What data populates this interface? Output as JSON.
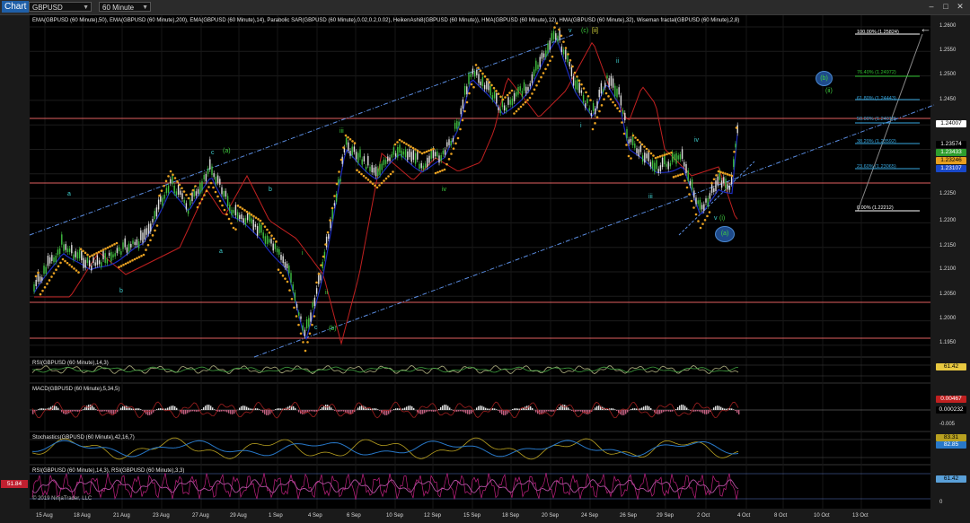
{
  "window": {
    "tab_label": "Chart",
    "symbol": "GBPUSD",
    "timeframe": "60 Minute",
    "min": "–",
    "max": "□",
    "close": "✕"
  },
  "main_panel": {
    "indicators_label": "EMA(GBPUSD (60 Minute),50), EMA(GBPUSD (60 Minute),200), EMA(GBPUSD (60 Minute),14), Parabolic SAR(GBPUSD (60 Minute),0.02,0.2,0.02), HeikenAshi8(GBPUSD (60 Minute)), HMA(GBPUSD (60 Minute),12), HMA(GBPUSD (60 Minute),32), Wiseman fractal(GBPUSD (60 Minute),2,8)",
    "price_ticks": [
      "1.2600",
      "1.2550",
      "1.2500",
      "1.2450",
      "1.2400",
      "1.2350",
      "1.2300",
      "1.2250",
      "1.2200",
      "1.2150",
      "1.2100",
      "1.2050",
      "1.2000",
      "1.1950"
    ],
    "price_tags": [
      {
        "label": "1.24007",
        "bg": "#ffffff",
        "fg": "#000000"
      },
      {
        "label": "1.23574",
        "bg": "#000000",
        "fg": "#ffffff"
      },
      {
        "label": "1.23433",
        "bg": "#2e9e2e",
        "fg": "#ffffff"
      },
      {
        "label": "1.23246",
        "bg": "#e8a020",
        "fg": "#000000"
      },
      {
        "label": "1.23107",
        "bg": "#1848c8",
        "fg": "#ffffff"
      }
    ],
    "fib_levels": [
      {
        "label": "100.00% (1.25824)",
        "color": "#ffffff"
      },
      {
        "label": "76.40% (1.24972)",
        "color": "#2ec02e"
      },
      {
        "label": "61.80% (1.24443)",
        "color": "#38a8e0"
      },
      {
        "label": "50.00% (1.24018)",
        "color": "#38a8e0"
      },
      {
        "label": "38.20% (1.23592)",
        "color": "#38a8e0"
      },
      {
        "label": "23.60% (1.23065)",
        "color": "#38a8e0"
      },
      {
        "label": "0.00% (1.22212)",
        "color": "#ffffff"
      }
    ],
    "wave_labels": [
      {
        "t": "a",
        "c": "#40d0d0"
      },
      {
        "t": "b",
        "c": "#40d0d0"
      },
      {
        "t": "c",
        "c": "#40d0d0"
      },
      {
        "t": "(a)",
        "c": "#40d040"
      },
      {
        "t": "a",
        "c": "#40d0d0"
      },
      {
        "t": "b",
        "c": "#40d0d0"
      },
      {
        "t": "c",
        "c": "#40d0d0"
      },
      {
        "t": "(b)",
        "c": "#40d040"
      },
      {
        "t": "i",
        "c": "#40d040"
      },
      {
        "t": "ii",
        "c": "#40d040"
      },
      {
        "t": "iii",
        "c": "#40d040"
      },
      {
        "t": "iv",
        "c": "#40d040"
      },
      {
        "t": "v",
        "c": "#40d0d0"
      },
      {
        "t": "(c)",
        "c": "#40d040"
      },
      {
        "t": "[ii]",
        "c": "#e0e040"
      },
      {
        "t": "i",
        "c": "#40d0d0"
      },
      {
        "t": "ii",
        "c": "#40d0d0"
      },
      {
        "t": "iii",
        "c": "#40d0d0"
      },
      {
        "t": "iv",
        "c": "#40d0d0"
      },
      {
        "t": "v",
        "c": "#40d0d0"
      },
      {
        "t": "(i)",
        "c": "#40d040"
      },
      {
        "t": "(ii)",
        "c": "#40d040"
      }
    ],
    "circle_labels": [
      "(b)",
      "(a)"
    ]
  },
  "sub_panels": [
    {
      "label": "RSI(GBPUSD (60 Minute),14,3)",
      "tag": "61.42",
      "tag_bg": "#e8c840",
      "tag_fg": "#000"
    },
    {
      "label": "MACD(GBPUSD (60 Minute),5,34,5)",
      "tag": "0.00467",
      "tag_bg": "#c02020",
      "tag_fg": "#fff",
      "tag2": "0.000232",
      "tag2_bg": "#000",
      "tag2_fg": "#fff",
      "tick": "-0.005"
    },
    {
      "label": "Stochastics(GBPUSD (60 Minute),42,16,7)",
      "tag": "83.31",
      "tag_bg": "#b8a020",
      "tag_fg": "#000",
      "tag2": "82.85",
      "tag2_bg": "#2878c8",
      "tag2_fg": "#fff"
    },
    {
      "label": "RSI(GBPUSD (60 Minute),14,3), RSI(GBPUSD (60 Minute),3,3)",
      "tag": "61.42",
      "tag_bg": "#5aa0d8",
      "tag_fg": "#000",
      "left_tag": "51.84",
      "copyright": "© 2019 NinjaTrader, LLC",
      "tick": "0"
    }
  ],
  "date_labels": [
    "15 Aug",
    "18 Aug",
    "21 Aug",
    "23 Aug",
    "27 Aug",
    "29 Aug",
    "1 Sep",
    "4 Sep",
    "6 Sep",
    "10 Sep",
    "12 Sep",
    "15 Sep",
    "18 Sep",
    "20 Sep",
    "24 Sep",
    "26 Sep",
    "29 Sep",
    "2 Oct",
    "4 Oct",
    "8 Oct",
    "10 Oct",
    "13 Oct"
  ],
  "arrow": "←",
  "colors": {
    "ema50": "#c02020",
    "hma": "#1c2cc0",
    "sar": "#e8a020",
    "candle_up": "#e0e0e0",
    "candle_dn": "#40c040",
    "channel": "#5a8ce0",
    "hline": "#e06060"
  }
}
